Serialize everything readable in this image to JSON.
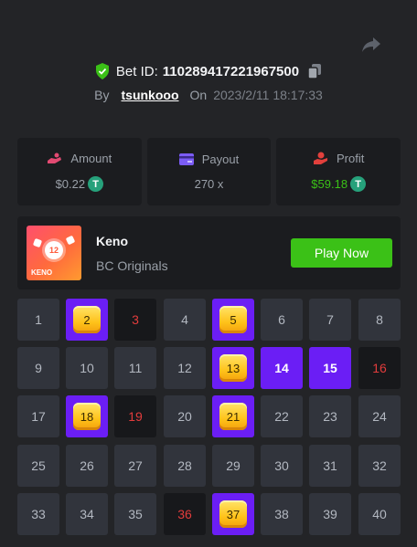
{
  "header": {
    "bet_label": "Bet ID:",
    "bet_id": "110289417221967500",
    "by_label": "By",
    "username": "tsunkooo",
    "on_label": "On",
    "date": "2023/2/11 18:17:33"
  },
  "stats": {
    "amount": {
      "label": "Amount",
      "value": "$0.22",
      "icon": "hand-coin-icon"
    },
    "payout": {
      "label": "Payout",
      "value": "270 x",
      "icon": "card-icon"
    },
    "profit": {
      "label": "Profit",
      "value": "$59.18",
      "icon": "hand-money-icon"
    },
    "currency_symbol": "T"
  },
  "game": {
    "name": "Keno",
    "provider": "BC Originals",
    "thumb_number": "12",
    "thumb_label": "KENO",
    "play_label": "Play Now"
  },
  "board": {
    "numbers": [
      "1",
      "2",
      "3",
      "4",
      "5",
      "6",
      "7",
      "8",
      "9",
      "10",
      "11",
      "12",
      "13",
      "14",
      "15",
      "16",
      "17",
      "18",
      "19",
      "20",
      "21",
      "22",
      "23",
      "24",
      "25",
      "26",
      "27",
      "28",
      "29",
      "30",
      "31",
      "32",
      "33",
      "34",
      "35",
      "36",
      "37",
      "38",
      "39",
      "40"
    ],
    "hits": [
      2,
      5,
      13,
      18,
      21,
      37
    ],
    "misses": [
      3,
      16,
      19,
      36
    ],
    "picks": [
      14,
      15
    ]
  },
  "colors": {
    "accent_purple": "#6b1ef5",
    "green": "#3bc117",
    "miss_red": "#e23c3c",
    "gem_gold": "#ffc21a"
  }
}
